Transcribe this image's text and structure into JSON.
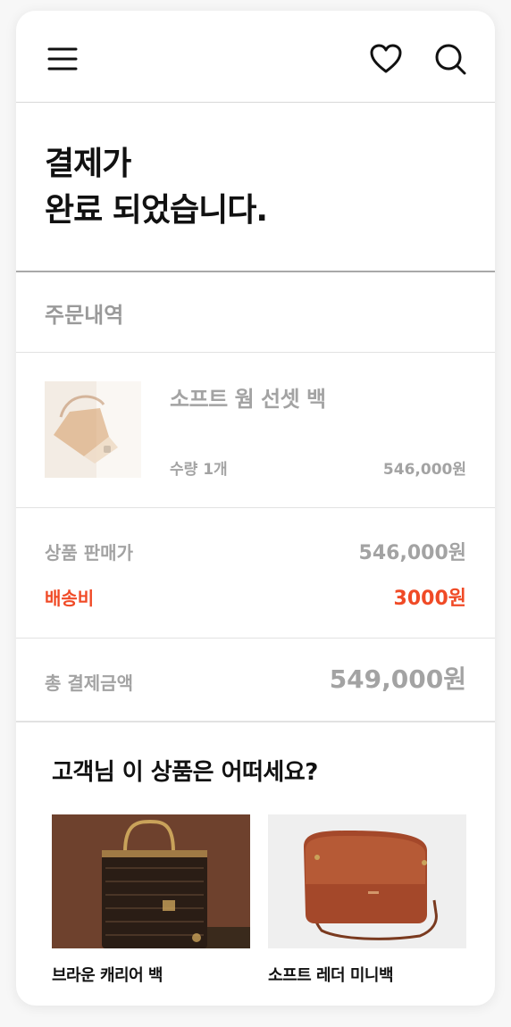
{
  "header": {
    "icons": [
      "hamburger-menu-icon",
      "heart-icon",
      "search-icon"
    ]
  },
  "title": {
    "line1": "결제가",
    "line2": "완료 되었습니다."
  },
  "order": {
    "section_label": "주문내역",
    "item": {
      "name": "소프트 웜 선셋 백",
      "quantity": "수량 1개",
      "price": "546,000원"
    }
  },
  "summary": {
    "product_price_label": "상품 판매가",
    "product_price_value": "546,000원",
    "shipping_label": "배송비",
    "shipping_value": "3000원",
    "total_label": "총 결제금액",
    "total_value": "549,000원"
  },
  "recommend": {
    "title": "고객님 이 상품은 어떠세요?",
    "items": [
      {
        "name": "브라운 캐리어 백"
      },
      {
        "name": "소프트 레더 미니백"
      }
    ]
  },
  "colors": {
    "accent": "#f04a26",
    "muted": "#a3a3a3",
    "text": "#111111"
  }
}
